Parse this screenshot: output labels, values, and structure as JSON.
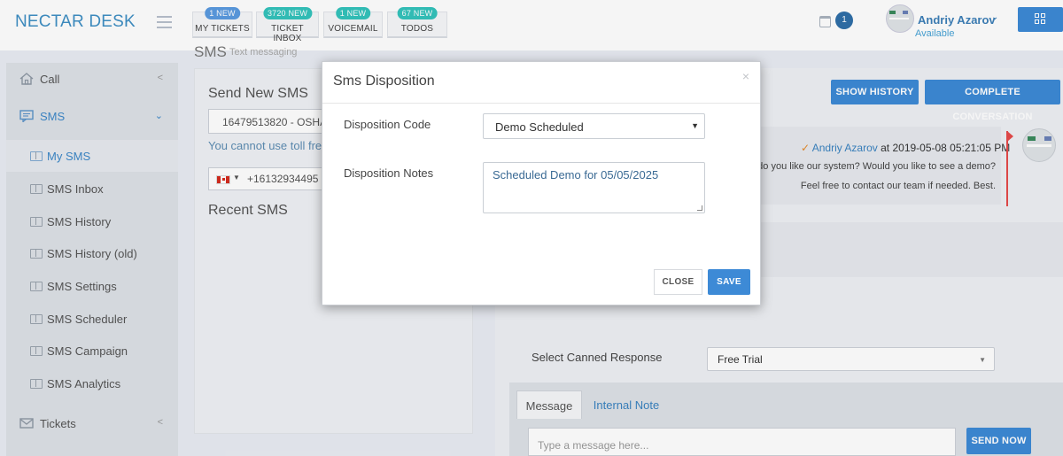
{
  "app": {
    "brand": "NECTAR DESK"
  },
  "nav_tabs": [
    {
      "label": "MY TICKETS",
      "badge": "1 NEW"
    },
    {
      "label": "TICKET INBOX",
      "badge": "3720 NEW"
    },
    {
      "label": "VOICEMAIL",
      "badge": "1 NEW"
    },
    {
      "label": "TODOS",
      "badge": "67 NEW"
    }
  ],
  "header": {
    "calendar_badge": "1",
    "user_name": "Andriy Azarov",
    "user_status": "Available",
    "icons": [
      "hamburger-icon",
      "calendar-icon",
      "chevron-down-icon",
      "grid-icon"
    ]
  },
  "sidebar": {
    "call": "Call",
    "sms": "SMS",
    "sms_items": [
      "My SMS",
      "SMS Inbox",
      "SMS History",
      "SMS History (old)",
      "SMS Settings",
      "SMS Scheduler",
      "SMS Campaign",
      "SMS Analytics"
    ],
    "tickets": "Tickets",
    "selected": "My SMS"
  },
  "page": {
    "title": "SMS",
    "subtitle": "Text messaging"
  },
  "send_sms": {
    "title": "Send New SMS",
    "from_number": "16479513820 - OSHAWA",
    "toll_note": "You cannot use toll free",
    "phone_number": "+16132934495",
    "recent_title": "Recent SMS"
  },
  "conversation": {
    "show_history": "SHOW HISTORY",
    "complete_conversation": "COMPLETE CONVERSATION",
    "author": "Andriy Azarov",
    "timestamp": "at 2019-05-08 05:21:05 PM",
    "line1": "ow do you like our system? Would you like to see a demo?",
    "line2": "Feel free to contact our team if needed. Best.",
    "canned_label": "Select Canned Response",
    "canned_value": "Free Trial",
    "tab_message": "Message",
    "tab_internal": "Internal Note",
    "message_placeholder": "Type a message here...",
    "send_now": "SEND NOW"
  },
  "modal": {
    "title": "Sms Disposition",
    "close_x": "×",
    "code_label": "Disposition Code",
    "code_value": "Demo Scheduled",
    "notes_label": "Disposition Notes",
    "notes_value": "Scheduled Demo for 05/05/2025",
    "close_btn": "CLOSE",
    "save_btn": "SAVE"
  },
  "colors": {
    "brand": "#3f8fc4",
    "primary_button": "#3d8ad6",
    "badge_blue": "#5a9be0",
    "badge_teal": "#33c3bc",
    "flag_red": "#e54a4a"
  }
}
